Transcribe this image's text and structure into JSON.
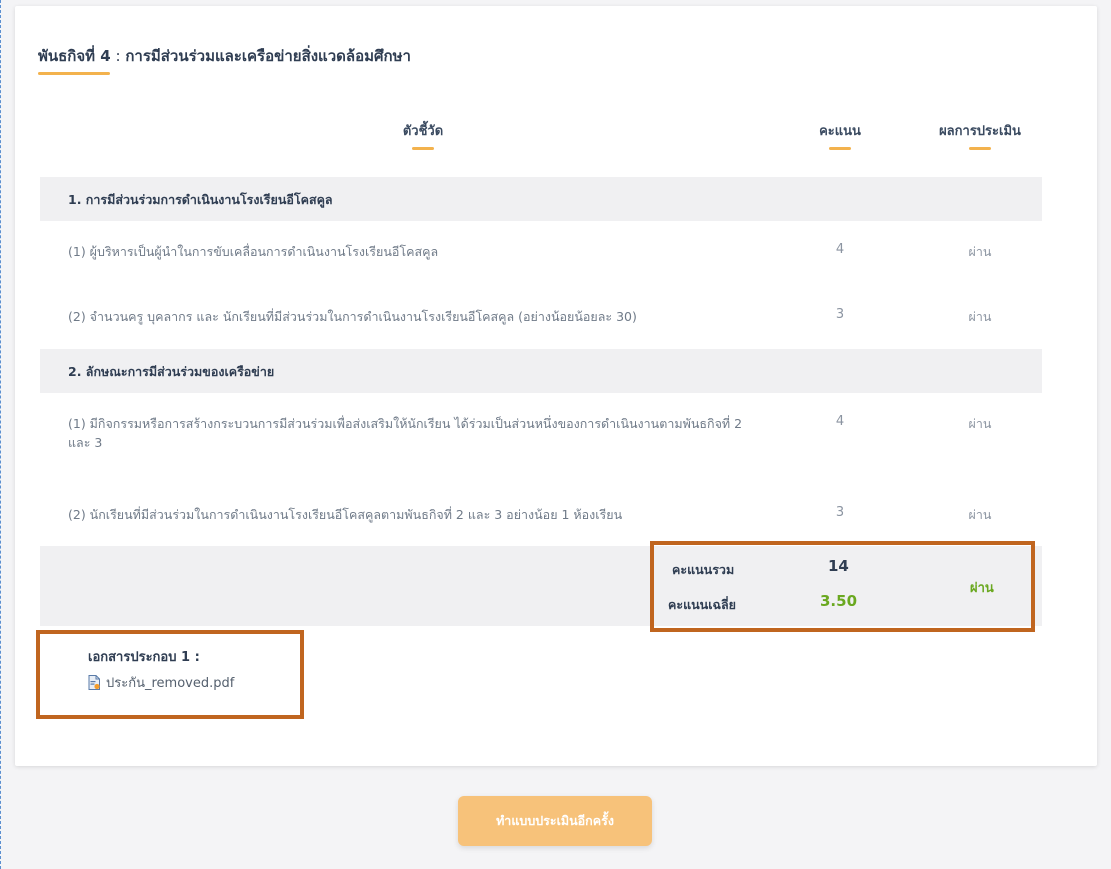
{
  "mission": {
    "prefix": "พันธกิจที่ 4",
    "sep": " : ",
    "title": "การมีส่วนร่วมและเครือข่ายสิ่งแวดล้อมศึกษา"
  },
  "columns": {
    "indicator": "ตัวชี้วัด",
    "score": "คะแนน",
    "result": "ผลการประเมิน"
  },
  "sections": [
    {
      "label": "1. การมีส่วนร่วมการดำเนินงานโรงเรียนอีโคสคูล",
      "items": [
        {
          "text": "(1) ผู้บริหารเป็นผู้นำในการขับเคลื่อนการดำเนินงานโรงเรียนอีโคสคูล",
          "score": "4",
          "result": "ผ่าน"
        },
        {
          "text": "(2) จำนวนครู บุคลากร และ นักเรียนที่มีส่วนร่วมในการดำเนินงานโรงเรียนอีโคสคูล (อย่างน้อยน้อยละ 30)",
          "score": "3",
          "result": "ผ่าน"
        }
      ]
    },
    {
      "label": "2. ลักษณะการมีส่วนร่วมของเครือข่าย",
      "items": [
        {
          "text": "(1) มีกิจกรรมหรือการสร้างกระบวนการมีส่วนร่วมเพื่อส่งเสริมให้นักเรียน ได้ร่วมเป็นส่วนหนึ่งของการดำเนินงานตามพันธกิจที่ 2 และ 3",
          "score": "4",
          "result": "ผ่าน"
        },
        {
          "text": "(2) นักเรียนที่มีส่วนร่วมในการดำเนินงานโรงเรียนอีโคสคูลตามพันธกิจที่ 2 และ 3 อย่างน้อย 1 ห้องเรียน",
          "score": "3",
          "result": "ผ่าน"
        }
      ]
    }
  ],
  "summary": {
    "total_label": "คะแนนรวม",
    "total_value": "14",
    "avg_label": "คะแนนเฉลี่ย",
    "avg_value": "3.50",
    "result": "ผ่าน"
  },
  "documents": {
    "label": "เอกสารประกอบ 1 :",
    "file_name": "ประกัน_removed.pdf",
    "file_icon": "pdf-file-icon"
  },
  "actions": {
    "retry_label": "ทำแบบประเมินอีกครั้ง"
  },
  "colors": {
    "accent": "#f3b24d",
    "pass_green": "#6aa820",
    "highlight": "#c0651f",
    "button": "#f7c27a"
  }
}
